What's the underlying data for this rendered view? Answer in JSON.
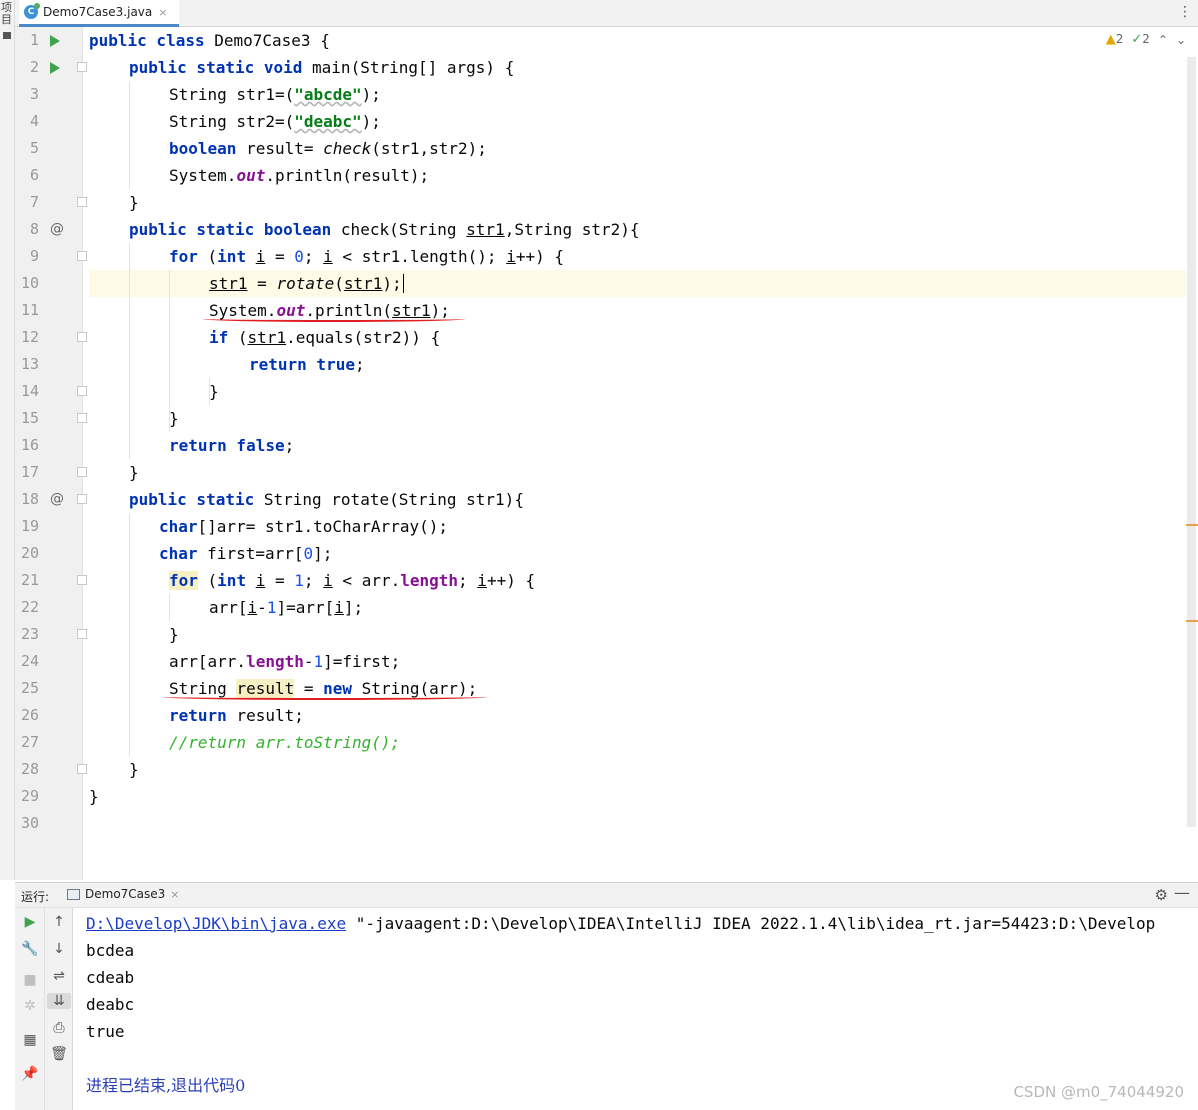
{
  "side_strip": {
    "chars": [
      "项",
      "目"
    ]
  },
  "editor_tab": {
    "file_name": "Demo7Case3.java",
    "file_icon": "C",
    "close": "×",
    "more": "⋮"
  },
  "inspection": {
    "warnings": "2",
    "typos": "2"
  },
  "line_numbers": [
    "1",
    "2",
    "3",
    "4",
    "5",
    "6",
    "7",
    "8",
    "9",
    "10",
    "11",
    "12",
    "13",
    "14",
    "15",
    "16",
    "17",
    "18",
    "19",
    "20",
    "21",
    "22",
    "23",
    "24",
    "25",
    "26",
    "27",
    "28",
    "29",
    "30"
  ],
  "code": {
    "l1": "public class Demo7Case3 {",
    "l2": "public static void main(String[] args) {",
    "l3": "String str1=(\"abcde\");",
    "l4": "String str2=(\"deabc\");",
    "l5": "boolean result= check(str1,str2);",
    "l6": "System.out.println(result);",
    "l7": "}",
    "l8": "public static boolean check(String str1,String str2){",
    "l9": "for (int i = 0; i < str1.length(); i++) {",
    "l10": "str1 = rotate(str1);",
    "l11": "System.out.println(str1);",
    "l12": "if (str1.equals(str2)) {",
    "l13": "return true;",
    "l14": "}",
    "l15": "}",
    "l16": "return false;",
    "l17": "}",
    "l18": "public static String rotate(String str1){",
    "l19": "char[]arr= str1.toCharArray();",
    "l20": "char first=arr[0];",
    "l21": "for (int i = 1; i < arr.length; i++) {",
    "l22": "arr[i-1]=arr[i];",
    "l23": "}",
    "l24": "arr[arr.length-1]=first;",
    "l25": "String result = new String(arr);",
    "l26": "return result;",
    "l27": "//return arr.toString();",
    "l28": "}",
    "l29": "}"
  },
  "run_panel": {
    "label": "运行:",
    "tab": "Demo7Case3",
    "tab_close": "×",
    "console": {
      "java_path": "D:\\Develop\\JDK\\bin\\java.exe",
      "command_rest": " \"-javaagent:D:\\Develop\\IDEA\\IntelliJ IDEA 2022.1.4\\lib\\idea_rt.jar=54423:D:\\Develop",
      "output": [
        "bcdea",
        "cdeab",
        "deabc",
        "true"
      ],
      "exit_message": "进程已结束,退出代码0"
    }
  },
  "watermark": "CSDN @m0_74044920",
  "colors": {
    "keyword": "#0033b3",
    "string": "#067d17",
    "number": "#1750eb",
    "field": "#871094",
    "comment": "#32b32b",
    "annotation_underline": "#e02020"
  }
}
